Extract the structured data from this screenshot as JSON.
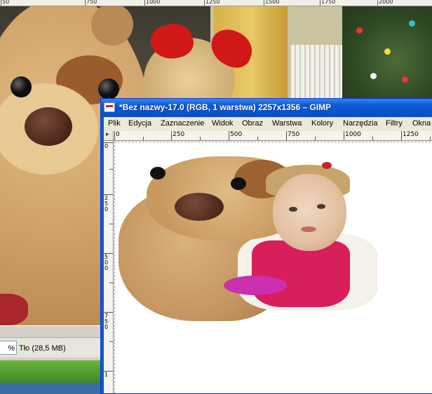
{
  "background_window": {
    "ruler_labels": [
      "50",
      "750",
      "1000",
      "1250",
      "1500",
      "1750",
      "2000"
    ],
    "zoom_value": "%",
    "layer_info": "Tło (28,5 MB)"
  },
  "window": {
    "title": "*Bez nazwy-17.0 (RGB, 1 warstwa) 2257x1356 – GIMP",
    "icon": "gimp-image-icon",
    "menu": [
      "Plik",
      "Edycja",
      "Zaznaczenie",
      "Widok",
      "Obraz",
      "Warstwa",
      "Kolory",
      "Narzędzia",
      "Filtry",
      "Okna"
    ],
    "h_ruler_labels": [
      "0",
      "250",
      "500",
      "750",
      "1000",
      "1250"
    ],
    "v_ruler_labels": [
      "0",
      "250",
      "500",
      "750",
      "1"
    ]
  },
  "colors": {
    "titlebar": "#0a5ad5",
    "menubar": "#ece9d8",
    "canvas": "#ffffff"
  }
}
